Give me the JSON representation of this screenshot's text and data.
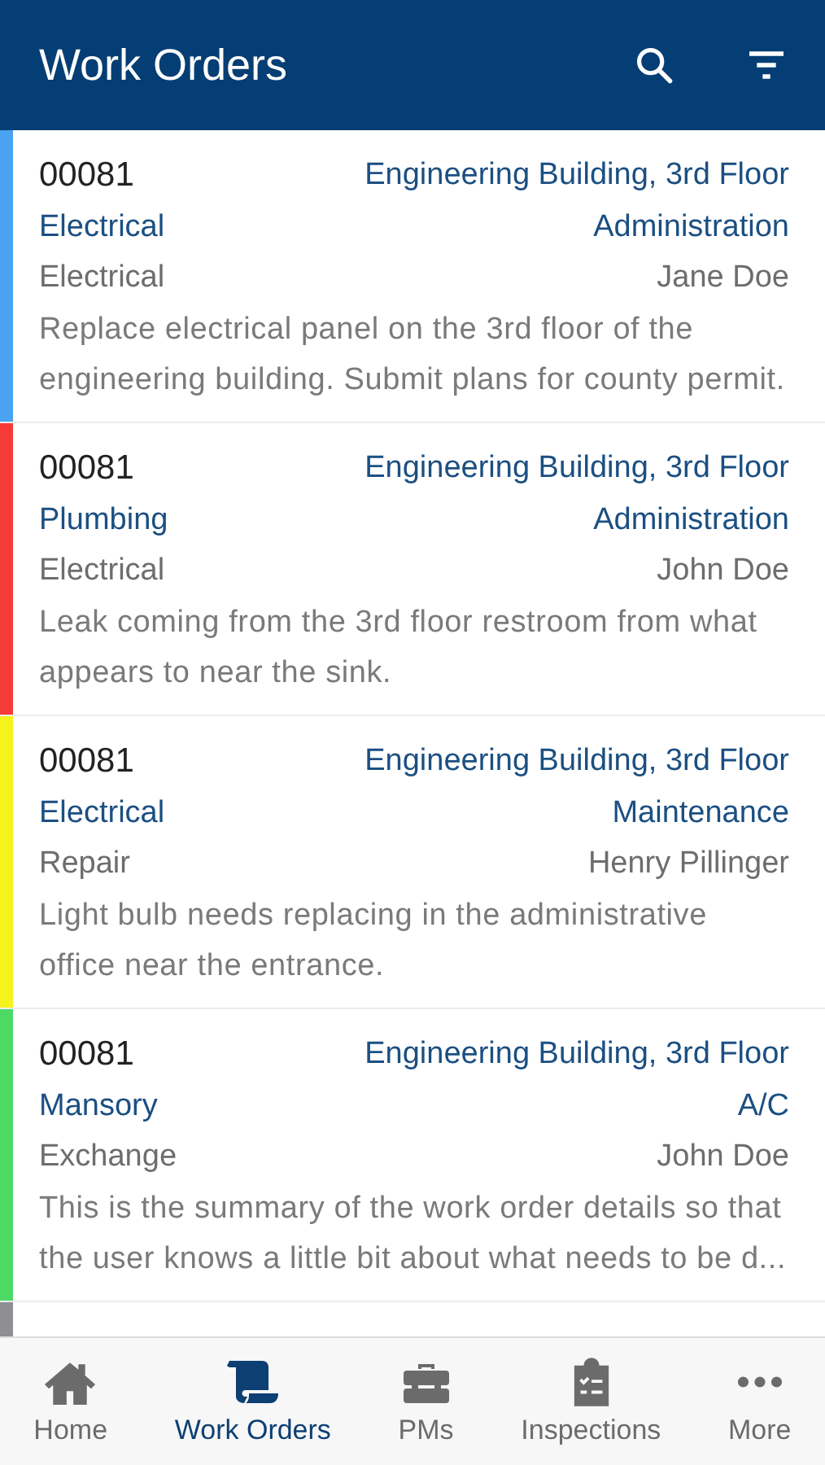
{
  "header": {
    "title": "Work Orders"
  },
  "work_orders": [
    {
      "number": "00081",
      "location": "Engineering Building, 3rd Floor",
      "trade": "Electrical",
      "department": "Administration",
      "type": "Electrical",
      "assignee": "Jane Doe",
      "description": "Replace electrical panel on the 3rd floor of the engineering building. Submit plans for county permit.",
      "color": "#4aa3f0"
    },
    {
      "number": "00081",
      "location": "Engineering Building, 3rd Floor",
      "trade": "Plumbing",
      "department": "Administration",
      "type": "Electrical",
      "assignee": "John Doe",
      "description": "Leak coming from the 3rd floor restroom from what appears to near the sink.",
      "color": "#f63a35"
    },
    {
      "number": "00081",
      "location": "Engineering Building, 3rd Floor",
      "trade": "Electrical",
      "department": "Maintenance",
      "type": "Repair",
      "assignee": "Henry Pillinger",
      "description": "Light bulb needs replacing in the administrative office near the entrance.",
      "color": "#f6f21c"
    },
    {
      "number": "00081",
      "location": "Engineering Building, 3rd Floor",
      "trade": "Mansory",
      "department": "A/C",
      "type": "Exchange",
      "assignee": "John Doe",
      "description": "This is the summary of the work order details so that the user knows a little bit about what needs to be d...",
      "color": "#4cd964"
    },
    {
      "color": "#8e8e93"
    }
  ],
  "tab_bar": [
    {
      "label": "Home",
      "selected": false
    },
    {
      "label": "Work Orders",
      "selected": true
    },
    {
      "label": "PMs",
      "selected": false
    },
    {
      "label": "Inspections",
      "selected": false
    },
    {
      "label": "More",
      "selected": false
    }
  ]
}
